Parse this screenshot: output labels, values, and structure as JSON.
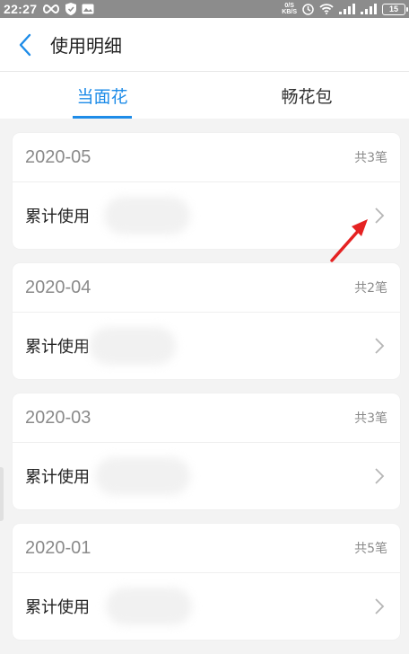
{
  "status_bar": {
    "time": "22:27",
    "net_speed_top": "0/S",
    "net_speed_bottom": "KB/S",
    "battery": "15"
  },
  "header": {
    "title": "使用明细"
  },
  "tabs": [
    {
      "label": "当面花",
      "active": true
    },
    {
      "label": "畅花包",
      "active": false
    }
  ],
  "cards": [
    {
      "month": "2020-05",
      "count": "共3笔",
      "label": "累计使用"
    },
    {
      "month": "2020-04",
      "count": "共2笔",
      "label": "累计使用"
    },
    {
      "month": "2020-03",
      "count": "共3笔",
      "label": "累计使用"
    },
    {
      "month": "2020-01",
      "count": "共5笔",
      "label": "累计使用"
    }
  ],
  "colors": {
    "accent": "#1e8ce8",
    "annotation": "#e52222",
    "status_bar": "#8c8c8c"
  }
}
